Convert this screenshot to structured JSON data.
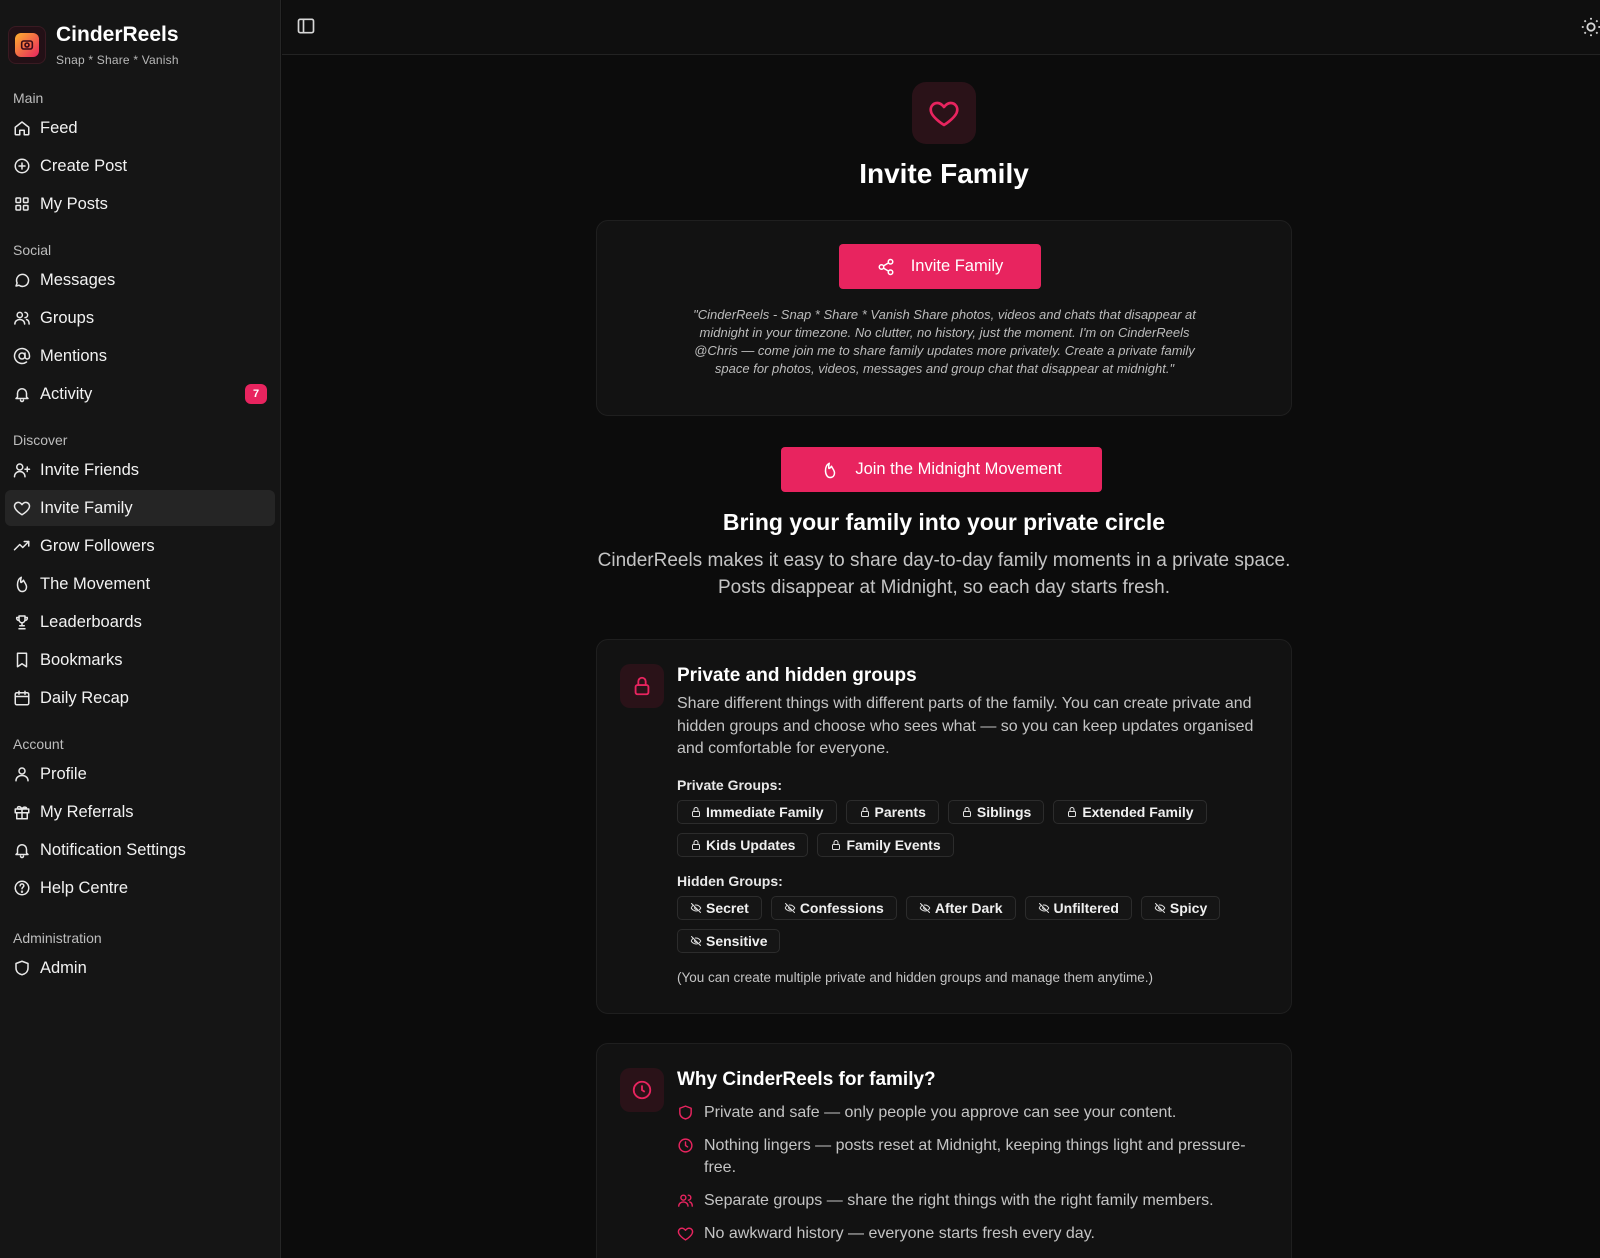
{
  "brand": {
    "name": "CinderReels",
    "tagline": "Snap * Share * Vanish"
  },
  "sidebar": {
    "sections": [
      {
        "title": "Main",
        "items": [
          {
            "label": "Feed",
            "icon": "home-icon"
          },
          {
            "label": "Create Post",
            "icon": "plus-circle-icon"
          },
          {
            "label": "My Posts",
            "icon": "grid-icon"
          }
        ]
      },
      {
        "title": "Social",
        "items": [
          {
            "label": "Messages",
            "icon": "message-icon"
          },
          {
            "label": "Groups",
            "icon": "users-icon"
          },
          {
            "label": "Mentions",
            "icon": "at-icon"
          },
          {
            "label": "Activity",
            "icon": "bell-icon",
            "badge": "7"
          }
        ]
      },
      {
        "title": "Discover",
        "items": [
          {
            "label": "Invite Friends",
            "icon": "user-plus-icon"
          },
          {
            "label": "Invite Family",
            "icon": "heart-icon",
            "active": true
          },
          {
            "label": "Grow Followers",
            "icon": "trending-up-icon"
          },
          {
            "label": "The Movement",
            "icon": "flame-icon"
          },
          {
            "label": "Leaderboards",
            "icon": "trophy-icon"
          },
          {
            "label": "Bookmarks",
            "icon": "bookmark-icon"
          },
          {
            "label": "Daily Recap",
            "icon": "calendar-icon"
          }
        ]
      },
      {
        "title": "Account",
        "items": [
          {
            "label": "Profile",
            "icon": "user-icon"
          },
          {
            "label": "My Referrals",
            "icon": "gift-icon"
          },
          {
            "label": "Notification Settings",
            "icon": "bell-icon"
          },
          {
            "label": "Help Centre",
            "icon": "help-circle-icon"
          }
        ]
      },
      {
        "title": "Administration",
        "items": [
          {
            "label": "Admin",
            "icon": "shield-icon"
          }
        ]
      }
    ]
  },
  "page": {
    "title": "Invite Family",
    "invite_button": "Invite Family",
    "quote": "\"CinderReels - Snap * Share * Vanish Share photos, videos and chats that disappear at midnight in your timezone. No clutter, no history, just the moment. I'm on CinderReels @Chris — come join me to share family updates more privately. Create a private family space for photos, videos, messages and group chat that disappear at midnight.\"",
    "movement_button": "Join the Midnight Movement",
    "heading": "Bring your family into your private circle",
    "intro": "CinderReels makes it easy to share day-to-day family moments in a private space. Posts disappear at Midnight, so each day starts fresh."
  },
  "groups_card": {
    "title": "Private and hidden groups",
    "desc": "Share different things with different parts of the family. You can create private and hidden groups and choose who sees what — so you can keep updates organised and comfortable for everyone.",
    "private_label": "Private Groups:",
    "private_groups": [
      "Immediate Family",
      "Parents",
      "Siblings",
      "Extended Family",
      "Kids Updates",
      "Family Events"
    ],
    "hidden_label": "Hidden Groups:",
    "hidden_groups": [
      "Secret",
      "Confessions",
      "After Dark",
      "Unfiltered",
      "Spicy",
      "Sensitive"
    ],
    "note": "(You can create multiple private and hidden groups and manage them anytime.)"
  },
  "why_card": {
    "title": "Why CinderReels for family?",
    "items": [
      {
        "text": "Private and safe — only people you approve can see your content.",
        "icon": "shield-icon"
      },
      {
        "text": "Nothing lingers — posts reset at Midnight, keeping things light and pressure-free.",
        "icon": "clock-icon"
      },
      {
        "text": "Separate groups — share the right things with the right family members.",
        "icon": "users-icon"
      },
      {
        "text": "No awkward history — everyone starts fresh every day.",
        "icon": "heart-icon"
      }
    ]
  },
  "colors": {
    "accent": "#e8245f",
    "background": "#0c0c0c",
    "sidebar": "#151515"
  }
}
